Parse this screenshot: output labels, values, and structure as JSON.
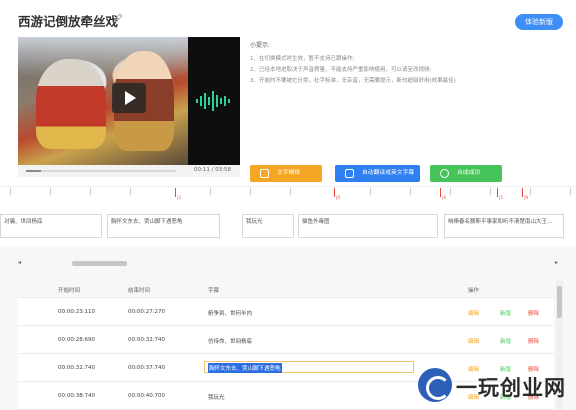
{
  "header": {
    "title": "西游记倒放牵丝戏",
    "experience_button": "体验新版"
  },
  "player": {
    "time": "00:11 / 03:58",
    "progress": 0.1
  },
  "tips": {
    "heading": "小提示:",
    "items": [
      "1、在切换模式时生效，暂不支持已跟操作;",
      "2、已经本地进取决于声音质量，不能支持严重影响使用，可以请至改视频;",
      "3、开始时不要被它分类，社字标准，无杂音，无需要提示，新句超级好用(效果最佳)"
    ]
  },
  "actions": {
    "manual_label": "文字精修",
    "auto_label": "自动翻译成英文字幕",
    "compose_label": "合成成功"
  },
  "timeline": {
    "marker_labels": [
      "|2",
      "|0",
      "|4",
      "|5",
      "|9"
    ],
    "segments": [
      "对骗、世间杨底",
      "胸怀文东去、贾山脚下遇恶龟",
      "我玩光",
      "猫鱼外毒图",
      "咱俸春名颤斯平事家和听不清楚南山大王..."
    ]
  },
  "table": {
    "headers": {
      "start": "开始时间",
      "end": "结束时间",
      "subtitle": "字幕",
      "ops": "操作"
    },
    "op_labels": {
      "edit": "编辑",
      "add": "新增",
      "del": "删除"
    },
    "rows": [
      {
        "start": "00:00:23:110",
        "end": "00:00:27:270",
        "subtitle": "俯争到、世何半内"
      },
      {
        "start": "00:00:28:690",
        "end": "00:00:32:740",
        "subtitle": "仿待命、世间杨底"
      },
      {
        "start": "00:00:32:740",
        "end": "00:00:37:740",
        "subtitle": "胸怀文东去、贾山脚下遇恶龟"
      },
      {
        "start": "00:00:38:740",
        "end": "00:00:40:700",
        "subtitle": "我玩光"
      }
    ]
  },
  "watermark": {
    "text": "一玩创业网"
  }
}
